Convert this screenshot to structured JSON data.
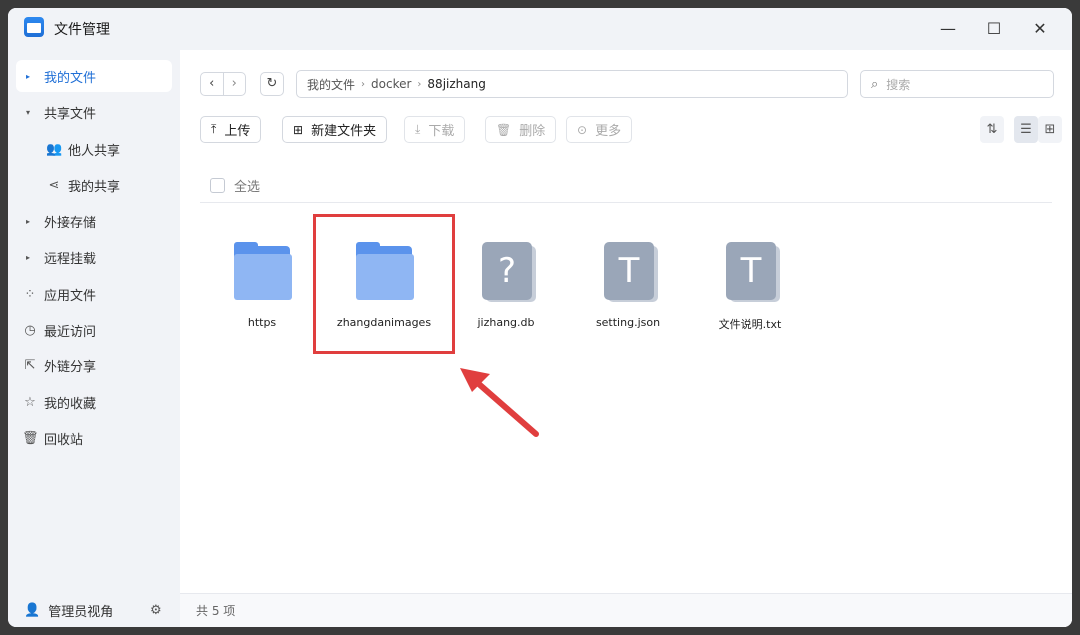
{
  "window": {
    "title": "文件管理",
    "controls": {
      "minimize": "—",
      "maximize": "☐",
      "close": "✕"
    }
  },
  "sidebar": {
    "items": [
      {
        "label": "我的文件",
        "arrow": "▸",
        "active": true
      },
      {
        "label": "共享文件",
        "arrow": "▾"
      },
      {
        "label": "他人共享",
        "icon": "users-icon",
        "sub": true
      },
      {
        "label": "我的共享",
        "icon": "share-icon",
        "sub": true
      },
      {
        "label": "外接存储",
        "arrow": "▸"
      },
      {
        "label": "远程挂载",
        "arrow": "▸"
      },
      {
        "label": "应用文件",
        "icon": "apps-icon"
      },
      {
        "label": "最近访问",
        "icon": "clock-icon"
      },
      {
        "label": "外链分享",
        "icon": "link-share-icon"
      },
      {
        "label": "我的收藏",
        "icon": "star-icon"
      },
      {
        "label": "回收站",
        "icon": "trash-icon"
      }
    ],
    "footer": {
      "label": "管理员视角",
      "icon": "user-icon",
      "settings_icon": "gear-icon"
    }
  },
  "toolbar": {
    "nav_back": "‹",
    "nav_forward": "›",
    "refresh": "↻",
    "path": [
      "我的文件",
      "docker",
      "88jizhang"
    ],
    "search_placeholder": "搜索",
    "buttons": [
      {
        "label": "上传",
        "icon": "upload-icon",
        "glyph": "⤒",
        "enabled": true
      },
      {
        "label": "新建文件夹",
        "icon": "new-folder-icon",
        "glyph": "⊞",
        "enabled": true
      },
      {
        "label": "下载",
        "icon": "download-icon",
        "glyph": "⤓",
        "enabled": false
      },
      {
        "label": "删除",
        "icon": "delete-icon",
        "glyph": "🗑",
        "enabled": false
      },
      {
        "label": "更多",
        "icon": "more-icon",
        "glyph": "⊙",
        "enabled": false
      }
    ],
    "sort_icon": "⇅",
    "list_view_icon": "☰",
    "grid_view_icon": "⊞"
  },
  "content": {
    "select_all": "全选",
    "files": [
      {
        "name": "https",
        "type": "folder"
      },
      {
        "name": "zhangdanimages",
        "type": "folder",
        "highlighted": true
      },
      {
        "name": "jizhang.db",
        "type": "unknown",
        "glyph": "?"
      },
      {
        "name": "setting.json",
        "type": "text",
        "glyph": "T"
      },
      {
        "name": "文件说明.txt",
        "type": "text",
        "glyph": "T"
      }
    ]
  },
  "status": {
    "count_text": "共 5 项"
  },
  "colors": {
    "accent": "#1f6fd6",
    "highlight": "#e03e3e",
    "folder": "#5b93ec"
  }
}
